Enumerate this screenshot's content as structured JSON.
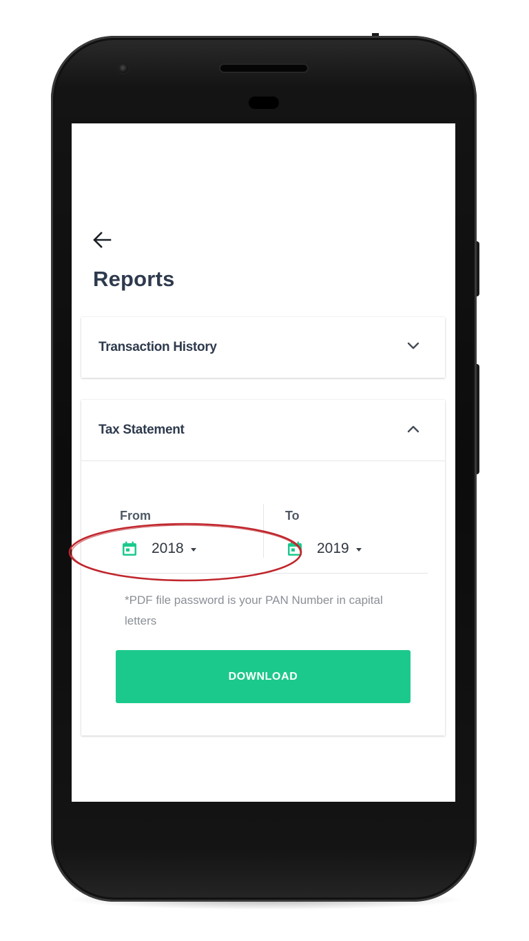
{
  "screen": {
    "title": "Reports",
    "back_icon": "arrow-left-icon"
  },
  "sections": {
    "transaction_history": {
      "title": "Transaction History",
      "expanded": false,
      "icon": "chevron-down-icon"
    },
    "tax_statement": {
      "title": "Tax Statement",
      "expanded": true,
      "icon": "chevron-up-icon",
      "from": {
        "label": "From",
        "value": "2018",
        "icon": "calendar-icon"
      },
      "to": {
        "label": "To",
        "value": "2019",
        "icon": "calendar-icon"
      },
      "note": "*PDF file password is your PAN Number in capital letters",
      "download_label": "DOWNLOAD"
    }
  },
  "colors": {
    "accent": "#1cc98c",
    "title": "#2e3a4d",
    "annotation": "#c0262d"
  }
}
